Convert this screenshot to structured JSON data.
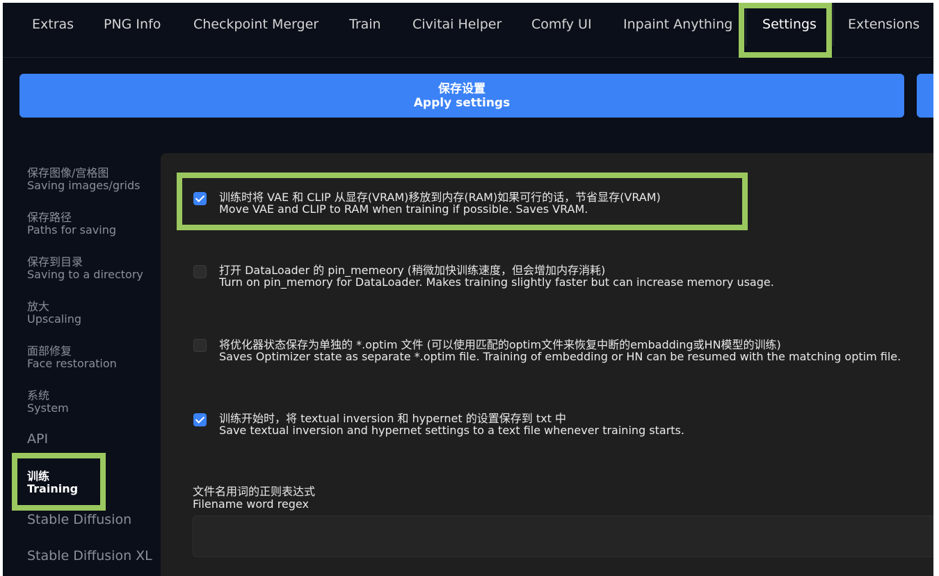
{
  "tabs": [
    {
      "label": "Extras"
    },
    {
      "label": "PNG Info"
    },
    {
      "label": "Checkpoint Merger"
    },
    {
      "label": "Train"
    },
    {
      "label": "Civitai Helper"
    },
    {
      "label": "Comfy UI"
    },
    {
      "label": "Inpaint Anything"
    },
    {
      "label": "Settings"
    },
    {
      "label": "Extensions"
    }
  ],
  "apply": {
    "zh": "保存设置",
    "en": "Apply settings"
  },
  "sidebar": {
    "items": [
      {
        "zh": "保存图像/宫格图",
        "en": "Saving images/grids"
      },
      {
        "zh": "保存路径",
        "en": "Paths for saving"
      },
      {
        "zh": "保存到目录",
        "en": "Saving to a directory"
      },
      {
        "zh": "放大",
        "en": "Upscaling"
      },
      {
        "zh": "面部修复",
        "en": "Face restoration"
      },
      {
        "zh": "系统",
        "en": "System"
      },
      {
        "label": "API"
      },
      {
        "zh": "训练",
        "en": "Training"
      },
      {
        "label": "Stable Diffusion"
      },
      {
        "label": "Stable Diffusion XL"
      }
    ]
  },
  "options": [
    {
      "zh": "训练时将 VAE 和 CLIP 从显存(VRAM)移放到内存(RAM)如果可行的话，节省显存(VRAM)",
      "en": "Move VAE and CLIP to RAM when training if possible. Saves VRAM.",
      "checked": true
    },
    {
      "zh": "打开 DataLoader 的 pin_memeory (稍微加快训练速度，但会增加内存消耗)",
      "en": "Turn on pin_memory for DataLoader. Makes training slightly faster but can increase memory usage.",
      "checked": false
    },
    {
      "zh": "将优化器状态保存为单独的 *.optim 文件 (可以使用匹配的optim文件来恢复中断的embadding或HN模型的训练)",
      "en": "Saves Optimizer state as separate *.optim file. Training of embedding or HN can be resumed with the matching optim file.",
      "checked": false
    },
    {
      "zh": "训练开始时，将 textual inversion 和 hypernet 的设置保存到 txt 中",
      "en": "Save textual inversion and hypernet settings to a text file whenever training starts.",
      "checked": true
    }
  ],
  "regex": {
    "zh": "文件名用词的正则表达式",
    "en": "Filename word regex",
    "value": ""
  },
  "colors": {
    "accent": "#3b82f6",
    "highlight": "#9ac85f",
    "background": "#0b0f19",
    "panel": "#1f1f1f"
  }
}
